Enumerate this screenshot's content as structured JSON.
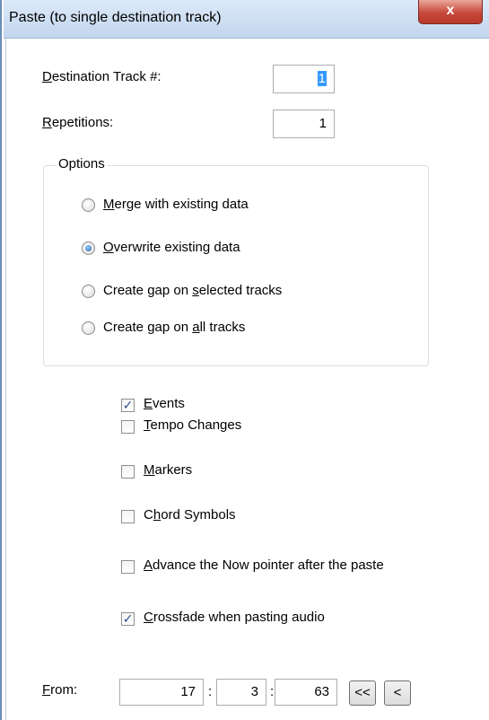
{
  "window": {
    "title": "Paste (to single destination track)",
    "close_glyph": "x"
  },
  "fields": {
    "dest_label_key": "D",
    "dest_label_rest": "estination Track #:",
    "dest_value": "1",
    "rep_label_key": "R",
    "rep_label_rest": "epetitions:",
    "rep_value": "1"
  },
  "options": {
    "title": "Options",
    "merge_key": "M",
    "merge_rest": "erge with existing data",
    "overwrite_key": "O",
    "overwrite_rest": "verwrite existing data",
    "gap_sel_pre": "Create gap on ",
    "gap_sel_key": "s",
    "gap_sel_post": "elected tracks",
    "gap_all_pre": "Create gap on ",
    "gap_all_key": "a",
    "gap_all_post": "ll tracks",
    "selected": "overwrite"
  },
  "checks": {
    "events_key": "E",
    "events_rest": "vents",
    "events_checked": true,
    "tempo_key": "T",
    "tempo_rest": "empo Changes",
    "tempo_checked": false,
    "markers_key": "M",
    "markers_rest": "arkers",
    "markers_checked": false,
    "chord_pre": "C",
    "chord_key": "h",
    "chord_post": "ord Symbols",
    "chord_checked": false,
    "advance_key": "A",
    "advance_rest": "dvance the Now pointer after the paste",
    "advance_checked": false,
    "crossfade_key": "C",
    "crossfade_rest": "rossfade when pasting audio",
    "crossfade_checked": true,
    "check_glyph": "✓"
  },
  "from": {
    "label_key": "F",
    "label_rest": "rom:",
    "bar": "17",
    "beat": "3",
    "tick": "63",
    "sep": ":",
    "rewind_label": "<<",
    "back_label": "<"
  }
}
